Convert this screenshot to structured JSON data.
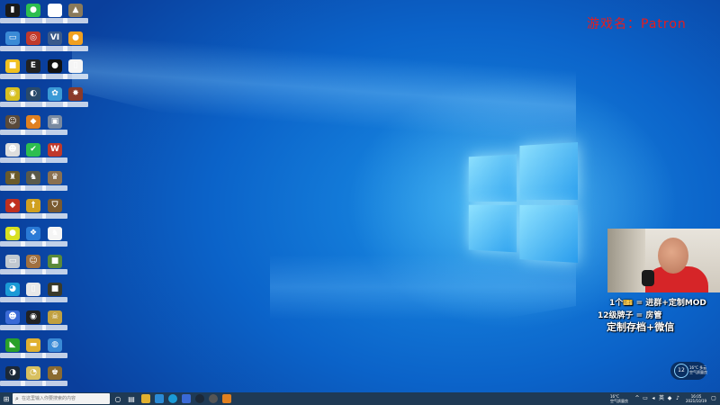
{
  "overlay": {
    "game_title": "游戏名：Patron",
    "line1": "1个🎫 = 进群+定制MOD",
    "line2": "12级牌子 = 房管",
    "line3": "定制存档+微信"
  },
  "weather": {
    "temp_circle": "12",
    "line1": "16°C 多云",
    "line2": "空气质量良"
  },
  "taskbar": {
    "search_placeholder": "在这里输入你要搜索的内容",
    "tray_temp": "16°C",
    "tray_weather": "空气质量良",
    "time": "16:05",
    "date": "2021/10/19"
  },
  "colors": {
    "title_red": "#e81c1c",
    "taskbar": "#1f3a55",
    "desktop_blue": "#0b63c9"
  },
  "desktop_icons": [
    {
      "name": "this-pc-icon",
      "glyph": "▮",
      "color": "#1a1a1a"
    },
    {
      "name": "wechat-icon",
      "glyph": "●",
      "color": "#2dbe4f"
    },
    {
      "name": "file-icon",
      "glyph": "▯",
      "color": "#ffffff"
    },
    {
      "name": "photo-icon",
      "glyph": "▲",
      "color": "#8a7a5a"
    },
    {
      "name": "laptop-icon",
      "glyph": "▭",
      "color": "#3a8ad6"
    },
    {
      "name": "target-icon",
      "glyph": "◎",
      "color": "#c0392b"
    },
    {
      "name": "vi-icon",
      "glyph": "VI",
      "color": "#3a5a8a"
    },
    {
      "name": "orange-app-icon",
      "glyph": "●",
      "color": "#f0a020"
    },
    {
      "name": "yellow-app-icon",
      "glyph": "■",
      "color": "#f0c020"
    },
    {
      "name": "epic-games-icon",
      "glyph": "E",
      "color": "#222222"
    },
    {
      "name": "qq-icon",
      "glyph": "●",
      "color": "#111111"
    },
    {
      "name": "document-icon",
      "glyph": "▯",
      "color": "#f5f5f5"
    },
    {
      "name": "disc-icon",
      "glyph": "◉",
      "color": "#d8c020"
    },
    {
      "name": "steam-like-icon",
      "glyph": "◐",
      "color": "#2a4a6a"
    },
    {
      "name": "network-icon",
      "glyph": "✿",
      "color": "#3a9ad6"
    },
    {
      "name": "gear-game-icon",
      "glyph": "✸",
      "color": "#8a3a2a"
    },
    {
      "name": "character-icon",
      "glyph": "☺",
      "color": "#5a4a3a"
    },
    {
      "name": "orange-game-icon",
      "glyph": "◆",
      "color": "#e08020"
    },
    {
      "name": "robot-icon",
      "glyph": "▣",
      "color": "#7a8aa0"
    },
    {
      "name": "ghost-icon",
      "glyph": "☻",
      "color": "#dddddd"
    },
    {
      "name": "green-check-icon",
      "glyph": "✔",
      "color": "#2dbe4f"
    },
    {
      "name": "w-game-icon",
      "glyph": "W",
      "color": "#c0392b"
    },
    {
      "name": "crest-icon",
      "glyph": "♜",
      "color": "#6a5a2a"
    },
    {
      "name": "soldier-icon",
      "glyph": "♞",
      "color": "#5a5a4a"
    },
    {
      "name": "helmet-icon",
      "glyph": "♛",
      "color": "#8a7050"
    },
    {
      "name": "red-game-icon",
      "glyph": "◆",
      "color": "#c03020"
    },
    {
      "name": "sword-icon",
      "glyph": "†",
      "color": "#d0a020"
    },
    {
      "name": "shield-game-icon",
      "glyph": "⛉",
      "color": "#7a5a30"
    },
    {
      "name": "lemon-icon",
      "glyph": "●",
      "color": "#d8e020"
    },
    {
      "name": "blue-bird-icon",
      "glyph": "❖",
      "color": "#2a7ad6"
    },
    {
      "name": "chess-icon",
      "glyph": "♞",
      "color": "#f5f5f5"
    },
    {
      "name": "drive-icon",
      "glyph": "▭",
      "color": "#c0c8d0"
    },
    {
      "name": "villager-icon",
      "glyph": "☺",
      "color": "#a07040"
    },
    {
      "name": "minecraft-icon",
      "glyph": "■",
      "color": "#5a8a3a"
    },
    {
      "name": "edge-icon",
      "glyph": "◕",
      "color": "#1a9ad6"
    },
    {
      "name": "blank-file-icon",
      "glyph": "▯",
      "color": "#e8e8e8"
    },
    {
      "name": "dark-game-icon",
      "glyph": "■",
      "color": "#3a3a2a"
    },
    {
      "name": "people-icon",
      "glyph": "☻",
      "color": "#3a6ad6"
    },
    {
      "name": "obs-icon",
      "glyph": "◉",
      "color": "#222222"
    },
    {
      "name": "skull-icon",
      "glyph": "☠",
      "color": "#c0a040"
    },
    {
      "name": "nvidia-icon",
      "glyph": "◣",
      "color": "#2aa02a"
    },
    {
      "name": "yellow-folder-icon",
      "glyph": "▬",
      "color": "#e0b030"
    },
    {
      "name": "globe-icon",
      "glyph": "◍",
      "color": "#3a8ad6"
    },
    {
      "name": "steam-icon",
      "glyph": "◑",
      "color": "#1b2838"
    },
    {
      "name": "clock-game-icon",
      "glyph": "◔",
      "color": "#d8c060"
    },
    {
      "name": "warrior-icon",
      "glyph": "♚",
      "color": "#8a6a30"
    }
  ]
}
